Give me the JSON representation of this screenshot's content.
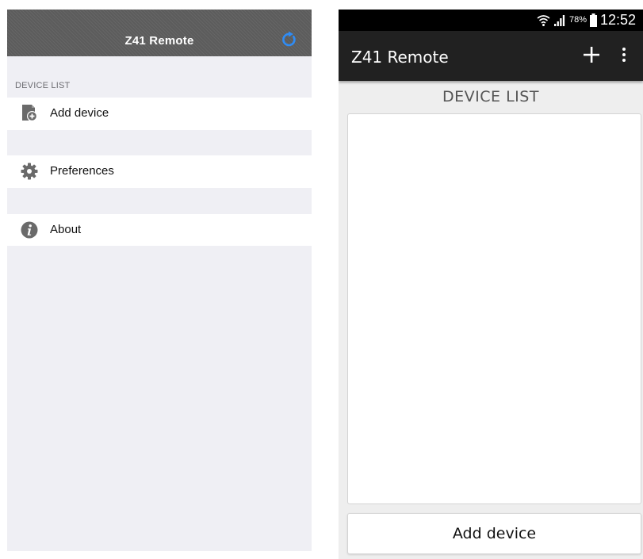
{
  "ios": {
    "title": "Z41 Remote",
    "refresh_icon": "refresh-icon",
    "section_header": "DEVICE LIST",
    "rows": [
      {
        "label": "Add device",
        "icon": "add-device-icon"
      },
      {
        "label": "Preferences",
        "icon": "gear-icon"
      },
      {
        "label": "About",
        "icon": "info-icon"
      }
    ],
    "colors": {
      "nav_bar": "#5c5c5c",
      "accent": "#2f8cf5",
      "background": "#efeff4"
    }
  },
  "android": {
    "status_bar": {
      "battery_percent": "78%",
      "time": "12:52",
      "icons": [
        "wifi-icon",
        "signal-icon",
        "battery-icon"
      ]
    },
    "title": "Z41 Remote",
    "actions": [
      "plus-icon",
      "more-vert-icon"
    ],
    "list_heading": "DEVICE LIST",
    "add_button_label": "Add device",
    "colors": {
      "action_bar": "#212121",
      "background": "#eeeeee"
    }
  }
}
